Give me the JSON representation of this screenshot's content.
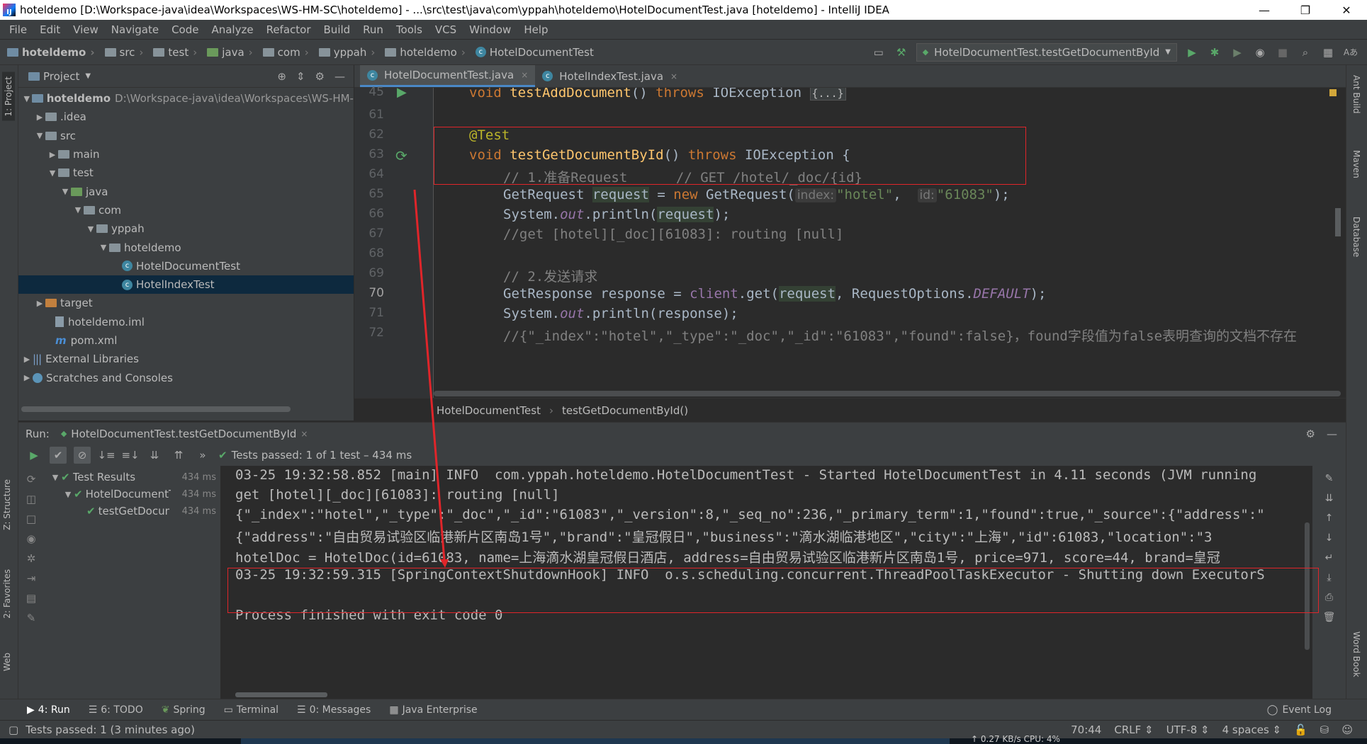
{
  "window": {
    "title": "hoteldemo [D:\\Workspace-java\\idea\\Workspaces\\WS-HM-SC\\hoteldemo] - ...\\src\\test\\java\\com\\yppah\\hoteldemo\\HotelDocumentTest.java [hoteldemo] - IntelliJ IDEA",
    "logo": "IJ",
    "minimize": "—",
    "restore": "❐",
    "close": "✕"
  },
  "menu": [
    "File",
    "Edit",
    "View",
    "Navigate",
    "Code",
    "Analyze",
    "Refactor",
    "Build",
    "Run",
    "Tools",
    "VCS",
    "Window",
    "Help"
  ],
  "nav": {
    "crumbs": [
      "hoteldemo",
      "src",
      "test",
      "java",
      "com",
      "yppah",
      "hoteldemo",
      "HotelDocumentTest"
    ],
    "sep": "›",
    "run_config": "HotelDocumentTest.testGetDocumentById",
    "dropdown": "▼",
    "icons": {
      "layout": "▭",
      "hammer": "⚒",
      "run": "▶",
      "debug": "✱",
      "coverage": "▶",
      "profile": "◉",
      "stop": "■",
      "search": "⌕",
      "structure": "▦",
      "translate": "Aあ"
    }
  },
  "left_strip": {
    "project": "1: Project",
    "structure": "Z: Structure",
    "favorites": "2: Favorites",
    "web": "Web"
  },
  "right_strip": {
    "ant": "Ant Build",
    "maven": "Maven",
    "database": "Database",
    "wordbook": "Word Book",
    "maven_glyph": "m"
  },
  "project": {
    "title": "Project",
    "dropdown": "▼",
    "icons": {
      "target": "⊕",
      "collapse": "⇕",
      "settings": "⚙",
      "hide": "—"
    },
    "rows": [
      {
        "label": "hoteldemo",
        "extra": "D:\\Workspace-java\\idea\\Workspaces\\WS-HM-",
        "arrow": "▼"
      },
      {
        "label": ".idea",
        "arrow": "▶"
      },
      {
        "label": "src",
        "arrow": "▼"
      },
      {
        "label": "main",
        "arrow": "▶"
      },
      {
        "label": "test",
        "arrow": "▼"
      },
      {
        "label": "java",
        "arrow": "▼"
      },
      {
        "label": "com",
        "arrow": "▼"
      },
      {
        "label": "yppah",
        "arrow": "▼"
      },
      {
        "label": "hoteldemo",
        "arrow": "▼"
      },
      {
        "label": "HotelDocumentTest",
        "arrow": ""
      },
      {
        "label": "HotelIndexTest",
        "arrow": ""
      },
      {
        "label": "target",
        "arrow": "▶"
      },
      {
        "label": "hoteldemo.iml",
        "arrow": ""
      },
      {
        "label": "pom.xml",
        "arrow": ""
      },
      {
        "label": "External Libraries",
        "arrow": "▶"
      },
      {
        "label": "Scratches and Consoles",
        "arrow": "▶"
      }
    ],
    "class_glyph": "c",
    "maven_glyph": "m",
    "lib_glyph": "|||"
  },
  "editor": {
    "tabs": [
      {
        "label": "HotelDocumentTest.java",
        "close": "×"
      },
      {
        "label": "HotelIndexTest.java",
        "close": "×"
      }
    ],
    "line_numbers": [
      "45",
      "61",
      "62",
      "63",
      "64",
      "65",
      "66",
      "67",
      "68",
      "69",
      "70",
      "71",
      "72"
    ],
    "code": {
      "l45_kw": "void",
      "l45_fn": "testAddDocument",
      "l45_rest": "() ",
      "l45_throws": "throws",
      "l45_exc": " IOException ",
      "l45_fold": "{...}",
      "l62": "@Test",
      "l63_kw": "void",
      "l63_fn": "testGetDocumentById",
      "l63_rest": "() ",
      "l63_throws": "throws",
      "l63_exc": " IOException {",
      "l64": "// 1.准备Request      // GET /hotel/_doc/{id}",
      "l65_a": "GetRequest ",
      "l65_var": "request",
      "l65_b": " = ",
      "l65_new": "new",
      "l65_c": " GetRequest(",
      "l65_hint1": "index:",
      "l65_s1": "\"hotel\"",
      "l65_d": ",  ",
      "l65_hint2": "id:",
      "l65_s2": "\"61083\"",
      "l65_e": ");",
      "l66_a": "System.",
      "l66_out": "out",
      "l66_b": ".println(",
      "l66_var": "request",
      "l66_c": ");",
      "l67": "//get [hotel][_doc][61083]: routing [null]",
      "l69": "// 2.发送请求",
      "l70_a": "GetResponse ",
      "l70_var": "response",
      "l70_b": " = ",
      "l70_client": "client",
      "l70_c": ".get(",
      "l70_var2": "request",
      "l70_d": ", RequestOptions.",
      "l70_const": "DEFAULT",
      "l70_e": ");",
      "l71_a": "System.",
      "l71_out": "out",
      "l71_b": ".println(response);",
      "l72": "//{\"_index\":\"hotel\",\"_type\":\"_doc\",\"_id\":\"61083\",\"found\":false}，found字段值为false表明查询的文档不存在"
    },
    "breadcrumb": [
      "HotelDocumentTest",
      "testGetDocumentById()"
    ],
    "breadcrumb_sep": "›"
  },
  "run": {
    "label": "Run:",
    "tab": "HotelDocumentTest.testGetDocumentById",
    "tab_close": "×",
    "head_icons": {
      "settings": "⚙",
      "hide": "—"
    },
    "toolbar": {
      "rerun": "▶",
      "passed": "✔",
      "ignored": "⊘",
      "sort_alpha": "↓≡",
      "sort_dur": "≡↓",
      "expand": "⇊",
      "collapse": "⇈",
      "more": "»"
    },
    "status": "Tests passed: 1 of 1 test – 434 ms",
    "status_check": "✔",
    "left_icons": [
      "⟳",
      "◫",
      "□",
      "◉",
      "✲",
      "⇥",
      "▤",
      "✎"
    ],
    "tree": [
      {
        "label": "Test Results",
        "dur": "434 ms",
        "arrow": "▼"
      },
      {
        "label": "HotelDocumentTest",
        "dur": "434 ms",
        "arrow": "▼"
      },
      {
        "label": "testGetDocumentById",
        "dur": "434 ms",
        "arrow": ""
      }
    ],
    "check": "✔",
    "console": [
      "03-25 19:32:58.852 [main] INFO  com.yppah.hoteldemo.HotelDocumentTest - Started HotelDocumentTest in 4.11 seconds (JVM running",
      "get [hotel][_doc][61083]: routing [null]",
      "{\"_index\":\"hotel\",\"_type\":\"_doc\",\"_id\":\"61083\",\"_version\":8,\"_seq_no\":236,\"_primary_term\":1,\"found\":true,\"_source\":{\"address\":\"",
      "{\"address\":\"自由贸易试验区临港新片区南岛1号\",\"brand\":\"皇冠假日\",\"business\":\"滴水湖临港地区\",\"city\":\"上海\",\"id\":61083,\"location\":\"3",
      "hotelDoc = HotelDoc(id=61083, name=上海滴水湖皇冠假日酒店, address=自由贸易试验区临港新片区南岛1号, price=971, score=44, brand=皇冠",
      "03-25 19:32:59.315 [SpringContextShutdownHook] INFO  o.s.scheduling.concurrent.ThreadPoolTaskExecutor - Shutting down ExecutorS",
      "",
      "Process finished with exit code 0"
    ],
    "right_icons": [
      "✎",
      "⇊",
      "↑",
      "↓",
      "↵",
      "⤓",
      "⎙",
      "🗑"
    ]
  },
  "bottom_tabs": [
    {
      "label": "4: Run",
      "icon": "▶"
    },
    {
      "label": "6: TODO",
      "icon": "☰"
    },
    {
      "label": "Spring",
      "icon": "❦"
    },
    {
      "label": "Terminal",
      "icon": "▭"
    },
    {
      "label": "0: Messages",
      "icon": "☰"
    },
    {
      "label": "Java Enterprise",
      "icon": "▦"
    }
  ],
  "event_log": "Event Log",
  "event_log_icon": "◯",
  "status": {
    "message": "Tests passed: 1 (3 minutes ago)",
    "msg_icon": "▢",
    "position": "70:44",
    "line_sep": "CRLF ⇕",
    "encoding": "UTF-8 ⇕",
    "indent": "4 spaces ⇕",
    "lock": "🔓",
    "vcs": "⛁",
    "face": "☺"
  },
  "taskbar": {
    "text": "↑ 0.27 KB/s     CPU: 4%"
  }
}
